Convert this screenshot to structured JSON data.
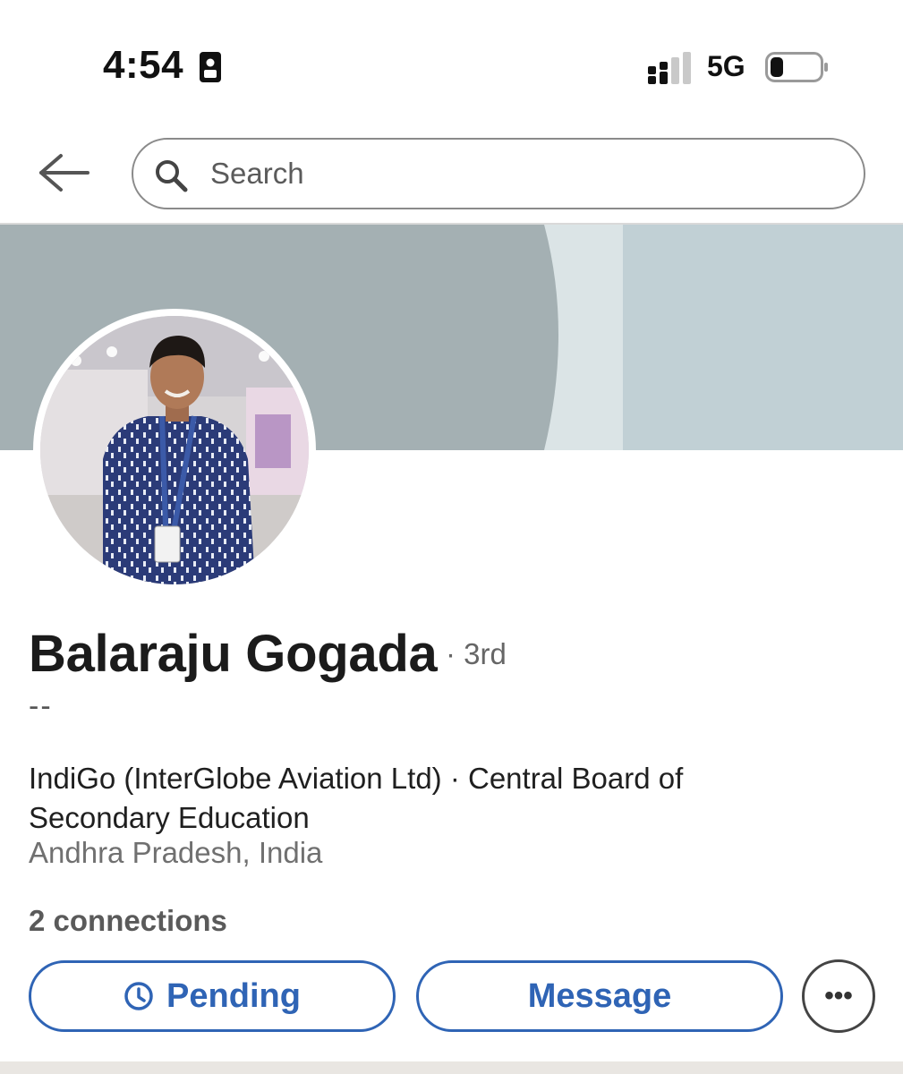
{
  "status_bar": {
    "time": "4:54",
    "network": "5G",
    "icons": [
      "sim-card-icon",
      "signal-bars-icon",
      "battery-icon"
    ]
  },
  "header": {
    "back_icon": "arrow-left-icon",
    "search_placeholder": "Search",
    "search_icon": "search-icon"
  },
  "profile": {
    "name": "Balaraju Gogada",
    "degree": "· 3rd",
    "headline": "--",
    "org_line": "IndiGo (InterGlobe Aviation Ltd) · Central Board of Secondary Education",
    "location": "Andhra Pradesh, India",
    "connections": "2 connections"
  },
  "actions": {
    "pending_label": "Pending",
    "pending_icon": "clock-icon",
    "message_label": "Message",
    "more_label": "•••"
  },
  "colors": {
    "accent": "#2f64b5",
    "cover_dark": "#a4b0b3",
    "cover_light": "#c1d0d5"
  }
}
